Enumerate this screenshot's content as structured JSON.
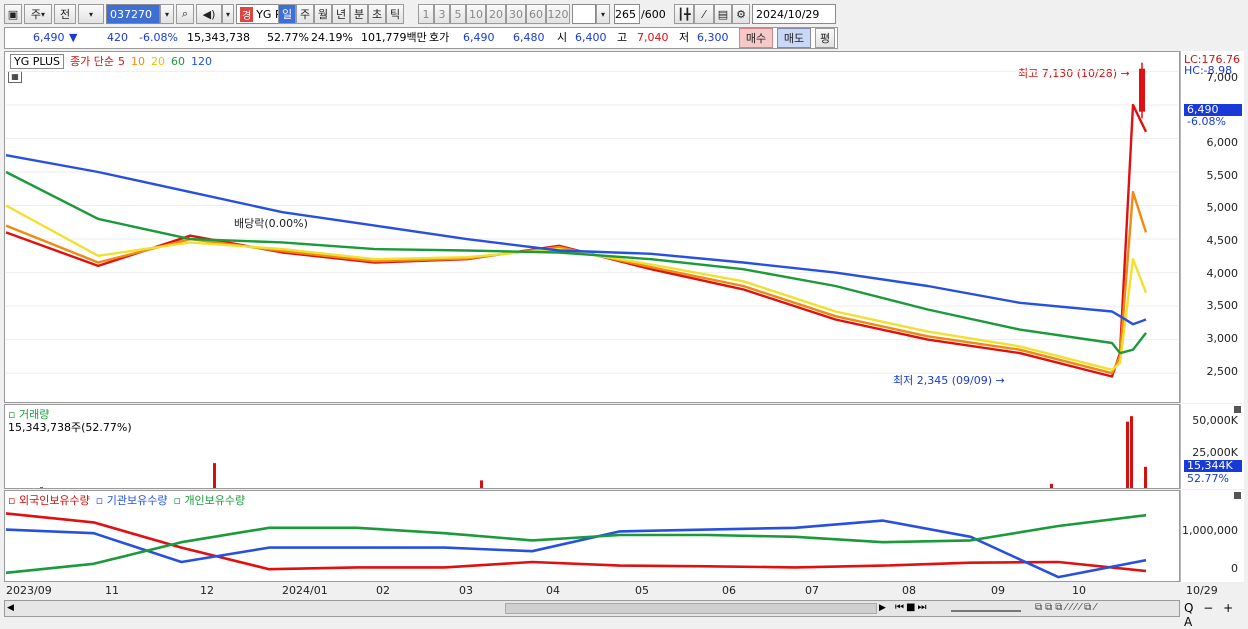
{
  "toolbar": {
    "type_prefix": "주",
    "type_label": "전",
    "code": "037270",
    "name_badge": "경",
    "name": "YG PLUS",
    "periods": [
      "일",
      "주",
      "월",
      "년",
      "분",
      "초",
      "틱"
    ],
    "active_period": "일",
    "intervals": [
      "1",
      "3",
      "5",
      "10",
      "20",
      "30",
      "60",
      "120"
    ],
    "count": "265",
    "count_total": "/600",
    "date": "2024/10/29"
  },
  "quote": {
    "price": "6,490",
    "change": "420",
    "change_pct": "-6.08%",
    "volume": "15,343,738",
    "vol_ratio": "52.77%",
    "turnover": "24.19%",
    "amount": "101,779백만",
    "bid_label": "호가",
    "ask": "6,490",
    "bid": "6,480",
    "open_label": "시",
    "open": "6,400",
    "high_label": "고",
    "high": "7,040",
    "low_label": "저",
    "low": "6,300",
    "buy_label": "매수",
    "sell_label": "매도",
    "avg_label": "평"
  },
  "price_panel": {
    "legend_name": "YG PLUS",
    "legend_ma_label": "종가 단순",
    "ma_periods": [
      "5",
      "10",
      "20",
      "60",
      "120"
    ],
    "ma_colors": [
      "#e01010",
      "#f08a10",
      "#f0e030",
      "#1a9a3a",
      "#2850e0"
    ],
    "lc": "LC:176.76",
    "hc": "HC:-8.98",
    "current_price": "6,490",
    "current_pct": "-6.08%",
    "max_note": "최고 7,130 (10/28)",
    "min_note": "최저 2,345 (09/09)",
    "dividend_note": "배당락(0.00%)",
    "y_ticks": [
      "7,000",
      "6,500",
      "6,000",
      "5,500",
      "5,000",
      "4,500",
      "4,000",
      "3,500",
      "3,000",
      "2,500"
    ]
  },
  "volume_panel": {
    "title": "거래량",
    "value": "15,343,738주(52.77%)",
    "current": "15,344K",
    "current_pct": "52.77%",
    "y_ticks": [
      "50,000K",
      "25,000K"
    ]
  },
  "holder_panel": {
    "series": [
      "외국인보유수량",
      "기관보유수량",
      "개인보유수량"
    ],
    "series_colors": [
      "#e01010",
      "#2850e0",
      "#1a9a3a"
    ],
    "y_ticks": [
      "1,000,000",
      "0"
    ]
  },
  "x_labels": [
    "2023/09",
    "11",
    "12",
    "2024/01",
    "02",
    "03",
    "04",
    "05",
    "06",
    "07",
    "08",
    "09",
    "10"
  ],
  "x_end": "10/29",
  "chart_data": [
    {
      "type": "line",
      "title": "YG PLUS 종가 단순",
      "ylim": [
        2100,
        7200
      ],
      "x": [
        "2023/09",
        "11",
        "12",
        "2024/01",
        "02",
        "03",
        "04",
        "05",
        "06",
        "07",
        "08",
        "09",
        "09/09",
        "10",
        "10/28",
        "10/29"
      ],
      "series": [
        {
          "name": "5",
          "values": [
            4600,
            4100,
            4550,
            4300,
            4150,
            4200,
            4400,
            4050,
            3750,
            3300,
            3000,
            2800,
            2450,
            2800,
            6500,
            6100
          ]
        },
        {
          "name": "10",
          "values": [
            4700,
            4150,
            4500,
            4320,
            4170,
            4210,
            4380,
            4080,
            3800,
            3350,
            3050,
            2850,
            2500,
            2750,
            5200,
            4600
          ]
        },
        {
          "name": "20",
          "values": [
            5000,
            4250,
            4450,
            4350,
            4200,
            4230,
            4350,
            4120,
            3870,
            3420,
            3120,
            2900,
            2550,
            2650,
            4200,
            3700
          ]
        },
        {
          "name": "60",
          "values": [
            5500,
            4800,
            4500,
            4450,
            4350,
            4330,
            4300,
            4200,
            4050,
            3800,
            3450,
            3150,
            2950,
            2800,
            2850,
            3100
          ]
        },
        {
          "name": "120",
          "values": [
            5750,
            5500,
            5200,
            4900,
            4700,
            4500,
            4330,
            4280,
            4150,
            4000,
            3800,
            3550,
            3420,
            3350,
            3230,
            3300
          ]
        }
      ],
      "annotations": [
        "최고 7,130 (10/28)",
        "최저 2,345 (09/09)",
        "배당락(0.00%)"
      ]
    },
    {
      "type": "bar",
      "title": "거래량",
      "ylim": [
        0,
        55000
      ],
      "x": [
        "2023/09",
        "12",
        "03",
        "10",
        "10/25",
        "10/28",
        "10/29"
      ],
      "series": [
        {
          "name": "거래량",
          "values": [
            600,
            18000,
            5500,
            3000,
            48000,
            52000,
            15344
          ]
        }
      ]
    },
    {
      "type": "line",
      "title": "보유수량",
      "ylim": [
        -200000,
        1800000
      ],
      "x": [
        "2023/09",
        "11",
        "12",
        "2024/01",
        "02",
        "03",
        "04",
        "05",
        "06",
        "07",
        "08",
        "09",
        "10",
        "10/29"
      ],
      "series": [
        {
          "name": "외국인보유수량",
          "values": [
            1650000,
            1400000,
            700000,
            100000,
            150000,
            150000,
            300000,
            200000,
            180000,
            150000,
            200000,
            280000,
            300000,
            50000
          ]
        },
        {
          "name": "기관보유수량",
          "values": [
            1200000,
            1100000,
            300000,
            700000,
            700000,
            700000,
            600000,
            1150000,
            1200000,
            1250000,
            1450000,
            1000000,
            -120000,
            350000
          ]
        },
        {
          "name": "개인보유수량",
          "values": [
            0,
            250000,
            850000,
            1250000,
            1250000,
            1100000,
            900000,
            1050000,
            1050000,
            1000000,
            850000,
            900000,
            1300000,
            1600000
          ]
        }
      ]
    }
  ]
}
